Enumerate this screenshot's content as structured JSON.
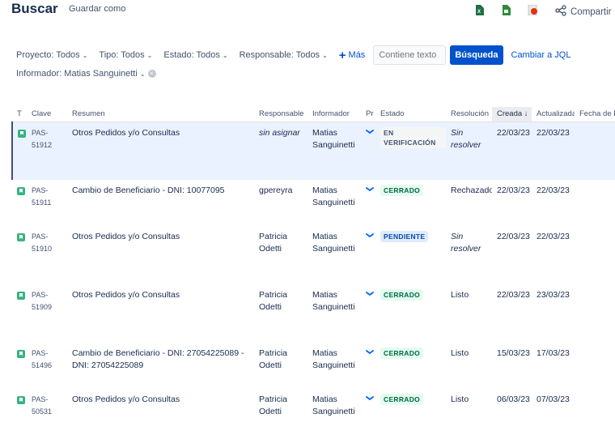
{
  "header": {
    "title": "Buscar",
    "save_as": "Guardar como",
    "share": "Compartir"
  },
  "filters": {
    "project": "Proyecto: Todos",
    "type": "Tipo: Todos",
    "status": "Estado: Todos",
    "assignee": "Responsable: Todos",
    "more": "Más",
    "text_placeholder": "Contiene texto",
    "search_button": "Búsqueda",
    "jql_link": "Cambiar a JQL",
    "reporter": "Informador: Matias Sanguinetti"
  },
  "columns": [
    "T",
    "Clave",
    "Resumen",
    "Responsable",
    "Informador",
    "Pr",
    "Estado",
    "Resolución",
    "Creada",
    "Actualizada",
    "Fecha de E"
  ],
  "sorted_column": "Creada",
  "rows": [
    {
      "key": "PAS-51912",
      "summary": "Otros Pedidos y/o Consultas",
      "assignee": "sin asignar",
      "assignee_italic": true,
      "reporter": "Matias Sanguinetti",
      "status": "EN VERIFICACIÓN",
      "status_kind": "verif",
      "resolution": "Sin resolver",
      "resolution_italic": true,
      "created": "22/03/23",
      "updated": "22/03/23",
      "selected": true,
      "height": 72
    },
    {
      "key": "PAS-51911",
      "summary": "Cambio de Beneficiario - DNI: 10077095",
      "assignee": "gpereyra",
      "assignee_italic": false,
      "reporter": "Matias Sanguinetti",
      "status": "CERRADO",
      "status_kind": "done",
      "resolution": "Rechazado",
      "resolution_italic": false,
      "created": "22/03/23",
      "updated": "22/03/23",
      "selected": false,
      "height": 57
    },
    {
      "key": "PAS-51910",
      "summary": "Otros Pedidos y/o Consultas",
      "assignee": "Patricia Odetti",
      "assignee_italic": false,
      "reporter": "Matias Sanguinetti",
      "status": "PENDIENTE",
      "status_kind": "pending",
      "resolution": "Sin resolver",
      "resolution_italic": true,
      "created": "22/03/23",
      "updated": "22/03/23",
      "selected": false,
      "height": 72
    },
    {
      "key": "PAS-51909",
      "summary": "Otros Pedidos y/o Consultas",
      "assignee": "Patricia Odetti",
      "assignee_italic": false,
      "reporter": "Matias Sanguinetti",
      "status": "CERRADO",
      "status_kind": "done",
      "resolution": "Listo",
      "resolution_italic": false,
      "created": "22/03/23",
      "updated": "23/03/23",
      "selected": false,
      "height": 72
    },
    {
      "key": "PAS-51496",
      "summary": "Cambio de Beneficiario - DNI: 27054225089 - DNI: 27054225089",
      "assignee": "Patricia Odetti",
      "assignee_italic": false,
      "reporter": "Matias Sanguinetti",
      "status": "CERRADO",
      "status_kind": "done",
      "resolution": "Listo",
      "resolution_italic": false,
      "created": "15/03/23",
      "updated": "17/03/23",
      "selected": false,
      "height": 57
    },
    {
      "key": "PAS-50531",
      "summary": "Otros Pedidos y/o Consultas",
      "assignee": "Patricia Odetti",
      "assignee_italic": false,
      "reporter": "Matias Sanguinetti",
      "status": "CERRADO",
      "status_kind": "done",
      "resolution": "Listo",
      "resolution_italic": false,
      "created": "06/03/23",
      "updated": "07/03/23",
      "selected": false,
      "height": 50
    }
  ],
  "icons": {
    "excel": "excel-icon",
    "csv": "csv-icon",
    "pdf": "pdf-icon",
    "share": "share-icon",
    "priority": "priority-low-icon",
    "issue_type": "story-icon"
  }
}
